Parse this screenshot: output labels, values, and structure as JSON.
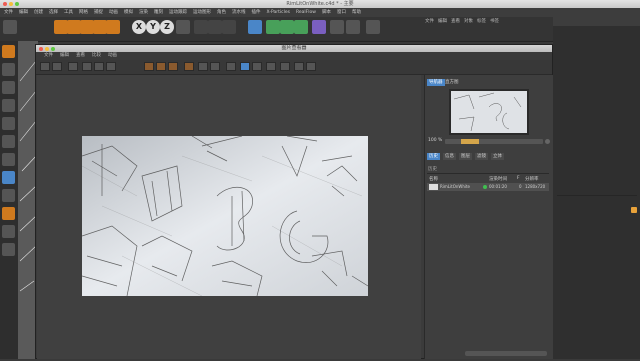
{
  "app": {
    "title": "RimLitOnWhite.c4d * - 主要",
    "menu": [
      "文件",
      "编辑",
      "创建",
      "选择",
      "工具",
      "网格",
      "捕捉",
      "动画",
      "模拟",
      "渲染",
      "雕刻",
      "运动跟踪",
      "运动图形",
      "角色",
      "流水线",
      "插件",
      "X-Particles",
      "RealFlow",
      "脚本",
      "窗口",
      "帮助"
    ],
    "right_menu": [
      "文件",
      "编辑",
      "查看",
      "对象",
      "标签",
      "书签"
    ],
    "toolbar_icons": [
      "undo-icon",
      "cursor-icon",
      "move-icon",
      "scale-icon",
      "rotate-icon",
      "add-icon",
      "x-axis-icon",
      "y-axis-icon",
      "z-axis-icon",
      "world-icon",
      "render-region-icon",
      "render-view-icon",
      "render-settings-icon",
      "cube-icon",
      "pen-icon",
      "subdivide-icon",
      "array-icon",
      "deformer-icon",
      "floor-icon",
      "camera-icon",
      "light-icon"
    ],
    "axis_labels": [
      "X",
      "Y",
      "Z"
    ],
    "colors": {
      "accent": "#4a86c8",
      "orange": "#d07a1e",
      "bg": "#3a3a3a"
    }
  },
  "viewer": {
    "title": "图片查看器",
    "menu": [
      "文件",
      "编辑",
      "查看",
      "比较",
      "动画"
    ],
    "tabs": {
      "navigator": "导航器",
      "histogram": "直方图"
    },
    "zoom": "100 %",
    "info_tabs": [
      "历史",
      "信息",
      "图层",
      "滤镜",
      "立体"
    ],
    "history_label": "历史",
    "table_headers": {
      "name": "名称",
      "render_time": "渲染时间",
      "frame": "F",
      "resolution": "分辨率"
    },
    "row": {
      "name": "RimLitOnWhite",
      "time": "00:01:20",
      "frame": "0",
      "resolution": "1280x720"
    }
  }
}
